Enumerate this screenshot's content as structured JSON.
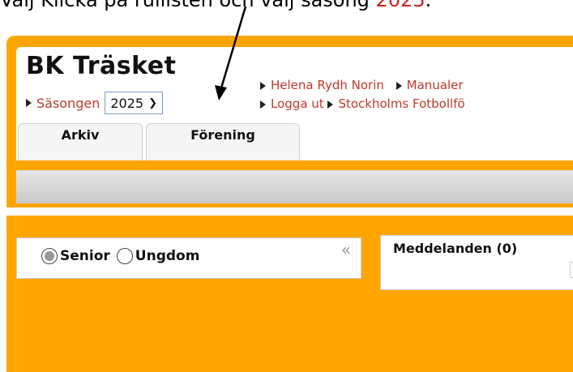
{
  "caption": {
    "text": "Välj Klicka på rullisten och välj säsong",
    "year": "2025",
    "end": "."
  },
  "header": {
    "club_name": "BK Träsket",
    "season_label": "Säsongen",
    "season_value": "2025",
    "links": {
      "user": "Helena Rydh Norin",
      "manuals": "Manualer",
      "logout": "Logga ut",
      "federation": "Stockholms Fotbollfö"
    }
  },
  "tabs": [
    {
      "label": "Arkiv"
    },
    {
      "label": "Förening"
    }
  ],
  "filter": {
    "options": [
      {
        "label": "Senior",
        "checked": true
      },
      {
        "label": "Ungdom",
        "checked": false
      }
    ],
    "collapse_symbol": "«"
  },
  "messages": {
    "title": "Meddelanden (0)"
  },
  "colors": {
    "accent": "#FFA500",
    "link": "#c0392b",
    "caption_highlight": "#d02020"
  }
}
